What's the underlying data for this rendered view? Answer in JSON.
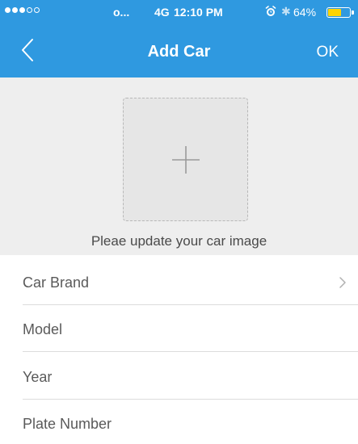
{
  "status_bar": {
    "carrier": "o...",
    "network": "4G",
    "time": "12:10 PM",
    "battery_percent": "64%",
    "battery_level": 0.64,
    "signal_filled": 3,
    "signal_total": 5,
    "icons": [
      "signal-dots",
      "alarm-icon",
      "bluetooth-icon",
      "battery-icon"
    ]
  },
  "navbar": {
    "back_icon": "chevron-left-icon",
    "title": "Add Car",
    "ok_label": "OK"
  },
  "image_upload": {
    "icon": "plus-icon",
    "hint": "Pleae update your car image"
  },
  "form": {
    "fields": [
      {
        "label": "Car Brand",
        "has_chevron": true
      },
      {
        "label": "Model",
        "has_chevron": false
      },
      {
        "label": "Year",
        "has_chevron": false
      },
      {
        "label": "Plate Number",
        "has_chevron": false
      }
    ]
  },
  "colors": {
    "accent": "#2f99e0",
    "battery_fill": "#ffd400",
    "image_area_bg": "#eeeeee",
    "label_text": "#5a5a5a"
  }
}
